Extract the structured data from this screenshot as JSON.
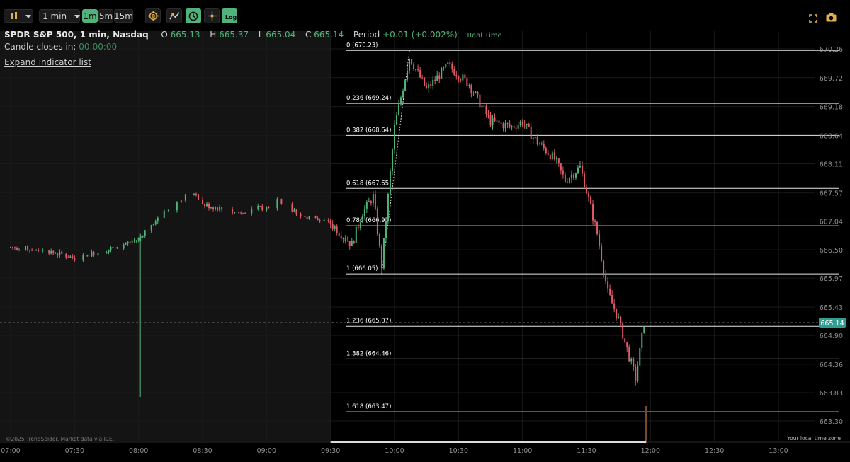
{
  "toolbar": {
    "interval_label": "1 min",
    "timeframes": [
      "1m",
      "5m",
      "15m"
    ],
    "active_timeframe": "1m",
    "log_label": "Log"
  },
  "header": {
    "symbol": "SPDR S&P 500, 1 min, Nasdaq",
    "o_label": "O",
    "o_value": "665.13",
    "h_label": "H",
    "h_value": "665.37",
    "l_label": "L",
    "l_value": "665.04",
    "c_label": "C",
    "c_value": "665.14",
    "period_label": "Period",
    "period_value": "+0.01 (+0.002%)",
    "realtime": "Real Time",
    "candle_closes_label": "Candle closes in:",
    "candle_closes_value": "00:00:00",
    "expand_indicators": "Expand indicator list"
  },
  "footer": {
    "copyright": "©2025 TrendSpider. Market data via ICE.",
    "timezone_note": "Your local time zone"
  },
  "colors": {
    "up": "#4fb37b",
    "down": "#e05a68",
    "background": "#000000",
    "premarket_bg": "#141414",
    "fib_line": "#e6e6e6",
    "price_tag": "#2f9e8e"
  },
  "chart_data": {
    "type": "candlestick",
    "y_axis": {
      "ticks": [
        "670.26",
        "669.72",
        "669.18",
        "668.64",
        "668.11",
        "667.57",
        "667.04",
        "666.50",
        "665.97",
        "665.43",
        "664.90",
        "664.36",
        "663.83",
        "663.30"
      ],
      "ylim": [
        663.0,
        670.45
      ]
    },
    "x_axis": {
      "ticks": [
        "07:00",
        "07:30",
        "08:00",
        "08:30",
        "09:00",
        "09:30",
        "10:00",
        "10:30",
        "11:00",
        "11:30",
        "12:00",
        "12:30",
        "13:00"
      ]
    },
    "last_price": "665.14",
    "fib_levels": [
      {
        "label": "0 (670.23)",
        "price": 670.23
      },
      {
        "label": "0.236 (669.24)",
        "price": 669.24
      },
      {
        "label": "0.382 (668.64)",
        "price": 668.64
      },
      {
        "label": "0.618 (667.65)",
        "price": 667.65
      },
      {
        "label": "0.786 (666.95)",
        "price": 666.95
      },
      {
        "label": "1 (666.05)",
        "price": 666.05
      },
      {
        "label": "1.236 (665.07)",
        "price": 665.07
      },
      {
        "label": "1.382 (664.46)",
        "price": 664.46
      },
      {
        "label": "1.618 (663.47)",
        "price": 663.47
      }
    ],
    "path_points": [
      [
        "07:00",
        666.55
      ],
      [
        "07:15",
        666.5
      ],
      [
        "07:30",
        666.35
      ],
      [
        "07:45",
        666.5
      ],
      [
        "08:00",
        666.7
      ],
      [
        "08:05",
        666.95
      ],
      [
        "08:15",
        667.3
      ],
      [
        "08:25",
        667.6
      ],
      [
        "08:30",
        667.35
      ],
      [
        "08:45",
        667.2
      ],
      [
        "09:00",
        667.3
      ],
      [
        "09:05",
        667.45
      ],
      [
        "09:15",
        667.15
      ],
      [
        "09:30",
        667.0
      ],
      [
        "09:40",
        666.6
      ],
      [
        "09:45",
        667.2
      ],
      [
        "09:50",
        667.5
      ],
      [
        "09:54",
        666.2
      ],
      [
        "10:00",
        668.8
      ],
      [
        "10:07",
        670.1
      ],
      [
        "10:15",
        669.5
      ],
      [
        "10:25",
        669.95
      ],
      [
        "10:35",
        669.6
      ],
      [
        "10:45",
        668.9
      ],
      [
        "10:55",
        668.8
      ],
      [
        "11:00",
        668.9
      ],
      [
        "11:05",
        668.6
      ],
      [
        "11:15",
        668.2
      ],
      [
        "11:20",
        667.8
      ],
      [
        "11:27",
        668.05
      ],
      [
        "11:30",
        667.6
      ],
      [
        "11:35",
        666.8
      ],
      [
        "11:40",
        665.7
      ],
      [
        "11:45",
        665.2
      ],
      [
        "11:50",
        664.5
      ],
      [
        "11:53",
        664.1
      ],
      [
        "11:55",
        664.6
      ],
      [
        "11:57",
        665.14
      ]
    ],
    "wick_spike": {
      "time": "08:00",
      "low": 663.75
    },
    "volume_bar": {
      "time": "11:58"
    }
  }
}
